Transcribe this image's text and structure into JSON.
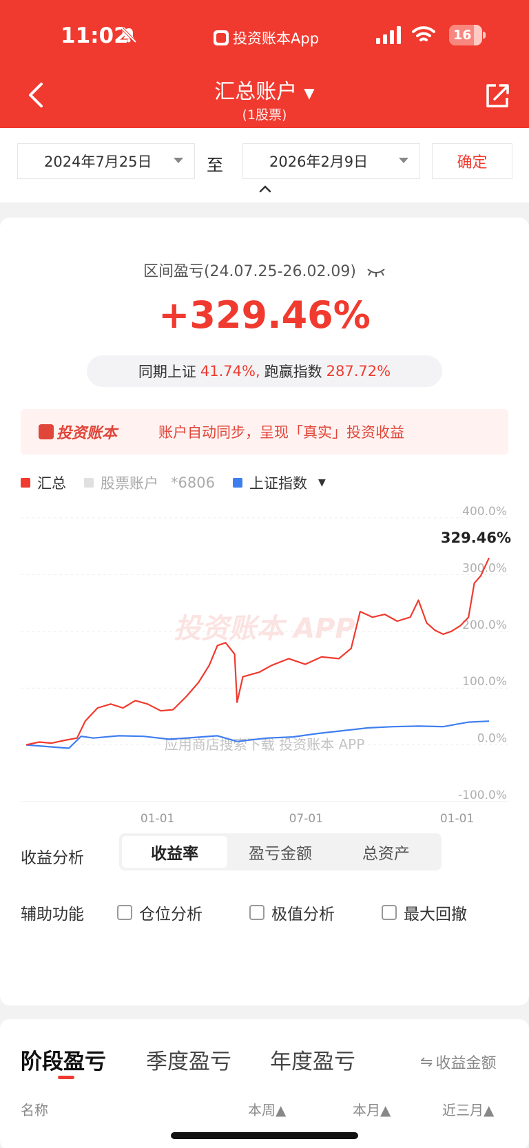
{
  "status_bar": {
    "time": "11:02",
    "app": "投资账本App",
    "battery": "16"
  },
  "header": {
    "title": "汇总账户",
    "subtitle": "(1股票)"
  },
  "date_range": {
    "from": "2024年7月25日",
    "sep": "至",
    "to": "2026年2月9日",
    "confirm": "确定"
  },
  "summary": {
    "range_label": "区间盈亏(24.07.25-26.02.09)",
    "return_pct": "+329.46%",
    "compare_a_label": "同期上证",
    "compare_a_value": "41.74%,",
    "compare_b_label": "跑赢指数",
    "compare_b_value": "287.72%"
  },
  "banner": {
    "logo": "投资账本",
    "text": "账户自动同步，呈现「真实」投资收益"
  },
  "legend": {
    "total": "汇总",
    "account": "股票账户",
    "account_no": "*6806",
    "index": "上证指数"
  },
  "colors": {
    "brand_red": "#f03a2f",
    "index_blue": "#3f7ef0",
    "account_gray": "#e0e0e0"
  },
  "chart_data": {
    "type": "line",
    "ylim": [
      -100,
      400
    ],
    "yticks": [
      "400.0%",
      "300.0%",
      "200.0%",
      "100.0%",
      "0.0%",
      "-100.0%"
    ],
    "xticks": [
      {
        "date": "2025-01-01",
        "label": "01-01"
      },
      {
        "date": "2025-07-01",
        "label": "07-01"
      },
      {
        "date": "2026-01-01",
        "label": "01-01"
      }
    ],
    "end_label": "329.46%",
    "watermark": "投资账本 APP",
    "download_text": "应用商店搜索下载",
    "download_brand": "投资账本 APP",
    "series": [
      {
        "name": "汇总",
        "color": "#f03a2f",
        "points": [
          [
            "2024-07-25",
            0
          ],
          [
            "2024-08-10",
            5
          ],
          [
            "2024-08-25",
            3
          ],
          [
            "2024-09-10",
            8
          ],
          [
            "2024-09-25",
            12
          ],
          [
            "2024-10-05",
            42
          ],
          [
            "2024-10-20",
            65
          ],
          [
            "2024-11-05",
            72
          ],
          [
            "2024-11-20",
            65
          ],
          [
            "2024-12-05",
            78
          ],
          [
            "2024-12-20",
            72
          ],
          [
            "2025-01-05",
            60
          ],
          [
            "2025-01-20",
            62
          ],
          [
            "2025-02-05",
            85
          ],
          [
            "2025-02-20",
            110
          ],
          [
            "2025-03-05",
            140
          ],
          [
            "2025-03-15",
            175
          ],
          [
            "2025-03-25",
            180
          ],
          [
            "2025-04-05",
            160
          ],
          [
            "2025-04-08",
            75
          ],
          [
            "2025-04-15",
            120
          ],
          [
            "2025-05-05",
            128
          ],
          [
            "2025-05-20",
            140
          ],
          [
            "2025-06-10",
            152
          ],
          [
            "2025-06-30",
            142
          ],
          [
            "2025-07-20",
            155
          ],
          [
            "2025-08-10",
            152
          ],
          [
            "2025-08-25",
            170
          ],
          [
            "2025-09-05",
            235
          ],
          [
            "2025-09-20",
            225
          ],
          [
            "2025-10-05",
            230
          ],
          [
            "2025-10-20",
            218
          ],
          [
            "2025-11-05",
            225
          ],
          [
            "2025-11-15",
            255
          ],
          [
            "2025-11-25",
            215
          ],
          [
            "2025-12-05",
            202
          ],
          [
            "2025-12-15",
            195
          ],
          [
            "2025-12-25",
            200
          ],
          [
            "2026-01-05",
            210
          ],
          [
            "2026-01-15",
            225
          ],
          [
            "2026-01-22",
            285
          ],
          [
            "2026-01-30",
            298
          ],
          [
            "2026-02-09",
            329.46
          ]
        ]
      },
      {
        "name": "上证指数",
        "color": "#3f7ef0",
        "points": [
          [
            "2024-07-25",
            0
          ],
          [
            "2024-08-20",
            -3
          ],
          [
            "2024-09-15",
            -6
          ],
          [
            "2024-09-30",
            15
          ],
          [
            "2024-10-15",
            12
          ],
          [
            "2024-11-15",
            16
          ],
          [
            "2024-12-15",
            15
          ],
          [
            "2025-01-15",
            10
          ],
          [
            "2025-02-15",
            13
          ],
          [
            "2025-03-15",
            16
          ],
          [
            "2025-04-08",
            6
          ],
          [
            "2025-05-15",
            12
          ],
          [
            "2025-06-15",
            14
          ],
          [
            "2025-07-15",
            20
          ],
          [
            "2025-08-15",
            25
          ],
          [
            "2025-09-15",
            30
          ],
          [
            "2025-10-15",
            32
          ],
          [
            "2025-11-15",
            33
          ],
          [
            "2025-12-15",
            32
          ],
          [
            "2026-01-15",
            40
          ],
          [
            "2026-02-09",
            41.74
          ]
        ]
      }
    ]
  },
  "analysis": {
    "label": "收益分析",
    "options": [
      "收益率",
      "盈亏金额",
      "总资产"
    ],
    "active": 0,
    "aux_label": "辅助功能",
    "aux_options": [
      "仓位分析",
      "极值分析",
      "最大回撤"
    ]
  },
  "bottom_tabs": {
    "tabs": [
      "阶段盈亏",
      "季度盈亏",
      "年度盈亏"
    ],
    "toggle": "收益金额",
    "columns": [
      "名称",
      "本周▲",
      "本月▲",
      "近三月▲"
    ]
  }
}
